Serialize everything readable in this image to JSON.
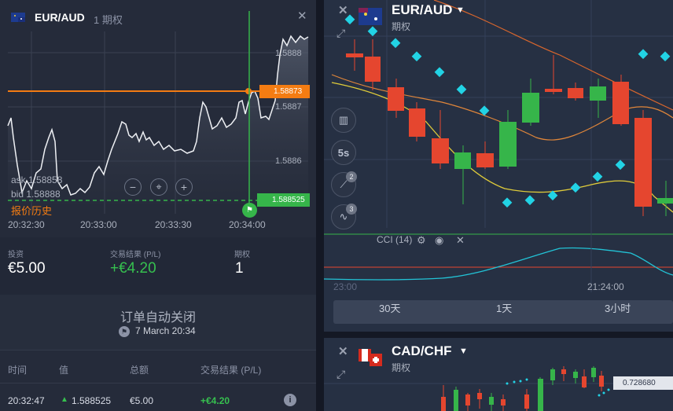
{
  "left": {
    "pair": "EUR/AUD",
    "type": "1 期权",
    "close": "✕",
    "prices": {
      "p1": "1.5888",
      "p2": "1.5887",
      "p3": "1.5886",
      "current": "1.58873",
      "strike": "1.588525"
    },
    "ask": "ask 1.58858",
    "bid": "bid 1.58888",
    "history": "报价历史",
    "times": [
      "20:32:30",
      "20:33:00",
      "20:33:30",
      "20:34:00"
    ],
    "stats": {
      "invest_label": "投资",
      "invest_value": "€5.00",
      "result_label": "交易结果 (P/L)",
      "result_value": "+€4.20",
      "options_label": "期权",
      "options_value": "1"
    },
    "autoclose": {
      "title": "订单自动关闭",
      "date": "7 March 20:34"
    },
    "table": {
      "headers": [
        "时间",
        "值",
        "总额",
        "交易结果 (P/L)"
      ],
      "row": {
        "time": "20:32:47",
        "value": "1.588525",
        "amount": "€5.00",
        "result": "+€4.20"
      }
    }
  },
  "chart_top": {
    "pair": "EUR/AUD",
    "type": "期权",
    "period_btn": "5s",
    "badge1": "2",
    "badge2": "3",
    "cci_label": "CCI (14)",
    "time_left": "23:00",
    "time_right": "21:24:00",
    "tabs": [
      "30天",
      "1天",
      "3小时"
    ]
  },
  "chart_bottom": {
    "pair": "CAD/CHF",
    "type": "期权",
    "price": "0.728680"
  },
  "colors": {
    "green": "#36b54a",
    "red": "#e5462f",
    "orange": "#f47c12",
    "cyan": "#22d3e5",
    "yellow": "#e0cc3a"
  }
}
